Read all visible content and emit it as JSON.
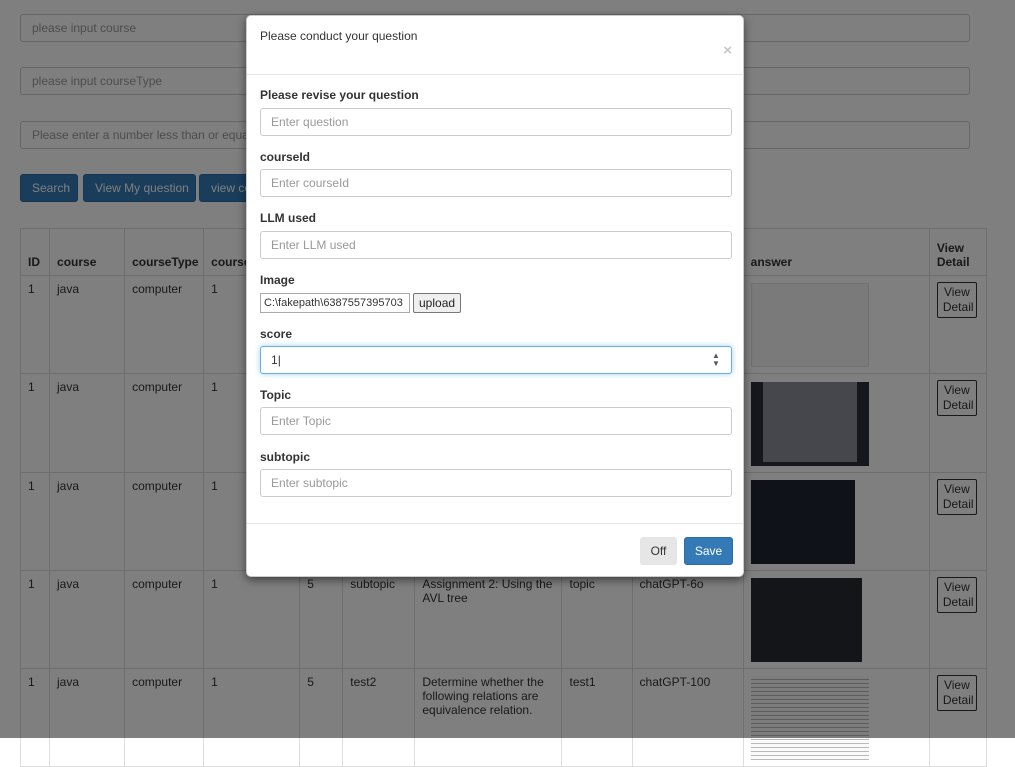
{
  "background": {
    "search_inputs": [
      {
        "placeholder": "please input course"
      },
      {
        "placeholder": "please input courseType"
      },
      {
        "placeholder": "Please enter a number less than or equal"
      }
    ],
    "buttons": {
      "search": "Search",
      "view_my_question": "View My question",
      "view_course": "view co"
    },
    "table": {
      "headers": [
        "ID",
        "course",
        "courseType",
        "course",
        "",
        "",
        "",
        "",
        "",
        "answer",
        "View Detail"
      ],
      "rows": [
        {
          "id": "1",
          "course": "java",
          "courseType": "computer",
          "courseId": "1",
          "score": "",
          "subtopic": "",
          "question": "",
          "topic": "",
          "llm": "",
          "thumb": "light",
          "detail": "View Detail"
        },
        {
          "id": "1",
          "course": "java",
          "courseType": "computer",
          "courseId": "1",
          "score": "",
          "subtopic": "",
          "question": "",
          "topic": "",
          "llm": "",
          "thumb": "mid",
          "detail": "View Detail"
        },
        {
          "id": "1",
          "course": "java",
          "courseType": "computer",
          "courseId": "1",
          "score": "",
          "subtopic": "",
          "question": "",
          "topic": "",
          "llm": "",
          "thumb": "dark",
          "detail": "View Detail"
        },
        {
          "id": "1",
          "course": "java",
          "courseType": "computer",
          "courseId": "1",
          "score": "5",
          "subtopic": "subtopic",
          "question": "Assignment 2: Using the AVL tree",
          "topic": "topic",
          "llm": "chatGPT-6o",
          "thumb": "dark2",
          "detail": "View Detail"
        },
        {
          "id": "1",
          "course": "java",
          "courseType": "computer",
          "courseId": "1",
          "score": "5",
          "subtopic": "test2",
          "question": "Determine whether the following relations are equivalence relation.",
          "topic": "test1",
          "llm": "chatGPT-100",
          "thumb": "text",
          "detail": "View Detail"
        }
      ]
    }
  },
  "modal": {
    "title": "Please conduct your question",
    "close": "×",
    "fields": {
      "question": {
        "label": "Please revise your question",
        "placeholder": "Enter question"
      },
      "courseId": {
        "label": "courseId",
        "placeholder": "Enter courseId"
      },
      "llm": {
        "label": "LLM used",
        "placeholder": "Enter LLM used"
      },
      "image": {
        "label": "Image",
        "file_path": "C:\\fakepath\\6387557395703",
        "upload": "upload"
      },
      "score": {
        "label": "score",
        "value": "1"
      },
      "topic": {
        "label": "Topic",
        "placeholder": "Enter Topic"
      },
      "subtopic": {
        "label": "subtopic",
        "placeholder": "Enter subtopic"
      }
    },
    "footer": {
      "off": "Off",
      "save": "Save"
    }
  },
  "colors": {
    "primary": "#337ab7",
    "overlay": "rgba(0,0,0,0.5)",
    "focus_border": "#66afe9"
  }
}
